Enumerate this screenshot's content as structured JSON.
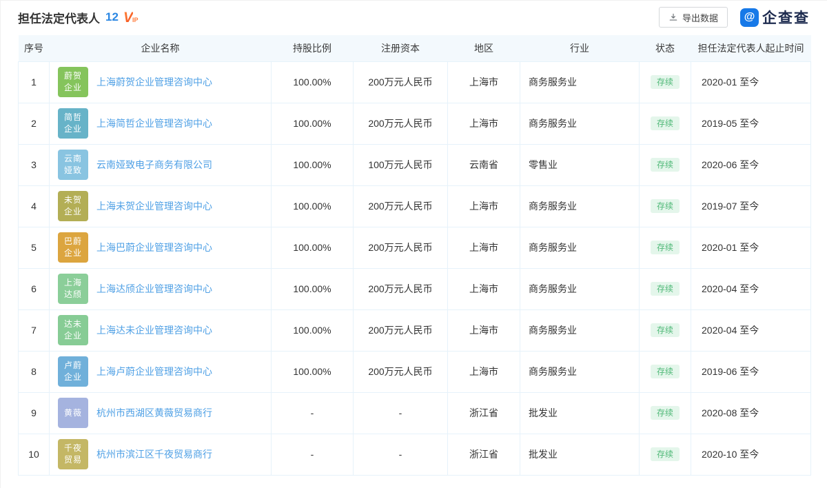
{
  "header": {
    "title": "担任法定代表人",
    "count": "12",
    "vip_v": "V",
    "vip_ip": "IP",
    "export_label": "导出数据",
    "brand_name": "企查查",
    "brand_glyph": "@"
  },
  "colors": {
    "accent_blue": "#2B87E3",
    "link_blue": "#4FA0E5",
    "brand_blue": "#1779E8",
    "status_green": "#4FB877",
    "status_green_bg": "#E4F6EB",
    "header_row_bg": "#F3F9FD",
    "grid_line": "#E6F2FA",
    "vip_orange": "#F95E1E"
  },
  "table": {
    "columns": [
      "序号",
      "企业名称",
      "持股比例",
      "注册资本",
      "地区",
      "行业",
      "状态",
      "担任法定代表人起止时间"
    ],
    "rows": [
      {
        "no": "1",
        "avatar_lines": [
          "蔚贺",
          "企业"
        ],
        "avatar_color": "#85C45C",
        "name": "上海蔚贺企业管理咨询中心",
        "ratio": "100.00%",
        "capital": "200万元人民币",
        "region": "上海市",
        "industry": "商务服务业",
        "status": "存续",
        "period": "2020-01 至今"
      },
      {
        "no": "2",
        "avatar_lines": [
          "简哲",
          "企业"
        ],
        "avatar_color": "#67B3C8",
        "name": "上海简哲企业管理咨询中心",
        "ratio": "100.00%",
        "capital": "200万元人民币",
        "region": "上海市",
        "industry": "商务服务业",
        "status": "存续",
        "period": "2019-05 至今"
      },
      {
        "no": "3",
        "avatar_lines": [
          "云南",
          "娅致"
        ],
        "avatar_color": "#89C4E1",
        "name": "云南娅致电子商务有限公司",
        "ratio": "100.00%",
        "capital": "100万元人民币",
        "region": "云南省",
        "industry": "零售业",
        "status": "存续",
        "period": "2020-06 至今"
      },
      {
        "no": "4",
        "avatar_lines": [
          "未贺",
          "企业"
        ],
        "avatar_color": "#B3AE55",
        "name": "上海未贺企业管理咨询中心",
        "ratio": "100.00%",
        "capital": "200万元人民币",
        "region": "上海市",
        "industry": "商务服务业",
        "status": "存续",
        "period": "2019-07 至今"
      },
      {
        "no": "5",
        "avatar_lines": [
          "巴蔚",
          "企业"
        ],
        "avatar_color": "#DCA53F",
        "name": "上海巴蔚企业管理咨询中心",
        "ratio": "100.00%",
        "capital": "200万元人民币",
        "region": "上海市",
        "industry": "商务服务业",
        "status": "存续",
        "period": "2020-01 至今"
      },
      {
        "no": "6",
        "avatar_lines": [
          "上海",
          "达颀"
        ],
        "avatar_color": "#8BCE99",
        "name": "上海达颀企业管理咨询中心",
        "ratio": "100.00%",
        "capital": "200万元人民币",
        "region": "上海市",
        "industry": "商务服务业",
        "status": "存续",
        "period": "2020-04 至今"
      },
      {
        "no": "7",
        "avatar_lines": [
          "达未",
          "企业"
        ],
        "avatar_color": "#87CC95",
        "name": "上海达未企业管理咨询中心",
        "ratio": "100.00%",
        "capital": "200万元人民币",
        "region": "上海市",
        "industry": "商务服务业",
        "status": "存续",
        "period": "2020-04 至今"
      },
      {
        "no": "8",
        "avatar_lines": [
          "卢蔚",
          "企业"
        ],
        "avatar_color": "#70B0DA",
        "name": "上海卢蔚企业管理咨询中心",
        "ratio": "100.00%",
        "capital": "200万元人民币",
        "region": "上海市",
        "industry": "商务服务业",
        "status": "存续",
        "period": "2019-06 至今"
      },
      {
        "no": "9",
        "avatar_lines": [
          "黄薇"
        ],
        "avatar_color": "#A5B3DF",
        "name": "杭州市西湖区黄薇贸易商行",
        "ratio": "-",
        "capital": "-",
        "region": "浙江省",
        "industry": "批发业",
        "status": "存续",
        "period": "2020-08 至今"
      },
      {
        "no": "10",
        "avatar_lines": [
          "千夜",
          "贸易"
        ],
        "avatar_color": "#C4B765",
        "name": "杭州市滨江区千夜贸易商行",
        "ratio": "-",
        "capital": "-",
        "region": "浙江省",
        "industry": "批发业",
        "status": "存续",
        "period": "2020-10 至今"
      }
    ]
  }
}
